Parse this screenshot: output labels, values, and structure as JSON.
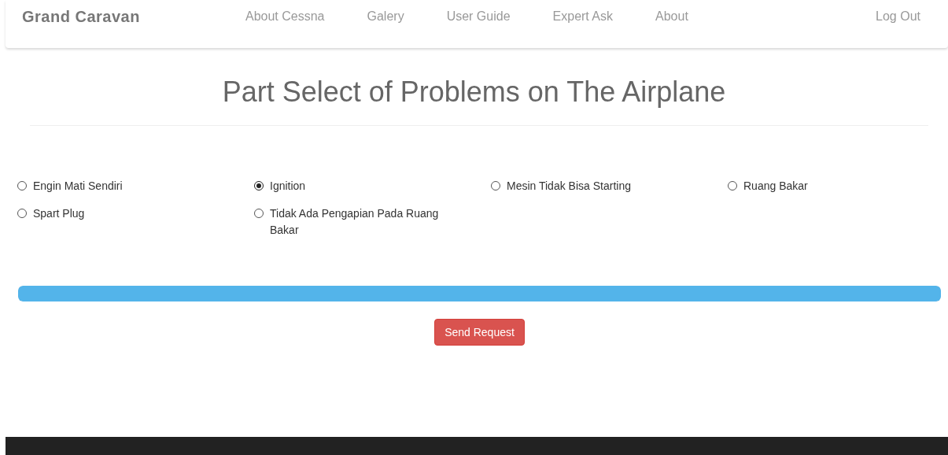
{
  "navbar": {
    "brand": "Grand Caravan",
    "links": [
      {
        "label": "About Cessna"
      },
      {
        "label": "Galery"
      },
      {
        "label": "User Guide"
      },
      {
        "label": "Expert Ask"
      },
      {
        "label": "About"
      }
    ],
    "logout": "Log Out"
  },
  "title": "Part Select of Problems on The Airplane",
  "options": [
    {
      "label": "Engin Mati Sendiri",
      "selected": false
    },
    {
      "label": "Ignition",
      "selected": true
    },
    {
      "label": "Mesin Tidak Bisa Starting",
      "selected": false
    },
    {
      "label": "Ruang Bakar",
      "selected": false
    },
    {
      "label": "Spart Plug",
      "selected": false
    },
    {
      "label": "Tidak Ada Pengapian Pada Ruang Bakar",
      "selected": false
    }
  ],
  "progress": {
    "level": 1
  },
  "submit": "Send Request"
}
